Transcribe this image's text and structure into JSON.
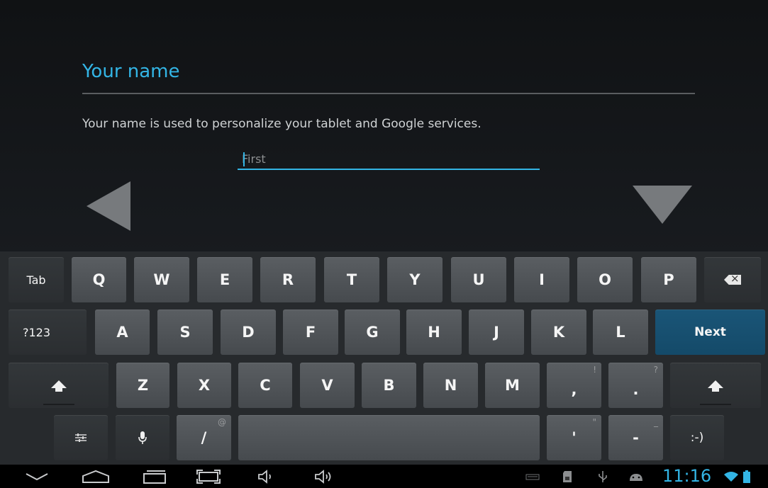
{
  "setup": {
    "title": "Your name",
    "description": "Your name is used to personalize your tablet and Google services.",
    "first_name_placeholder": "First",
    "first_name_value": ""
  },
  "keyboard": {
    "row1": [
      "Tab",
      "Q",
      "W",
      "E",
      "R",
      "T",
      "Y",
      "U",
      "I",
      "O",
      "P"
    ],
    "row2": [
      "?123",
      "A",
      "S",
      "D",
      "F",
      "G",
      "H",
      "J",
      "K",
      "L",
      "Next"
    ],
    "row3": [
      "Z",
      "X",
      "C",
      "V",
      "B",
      "N",
      "M",
      ",",
      "."
    ],
    "row3_hints": {
      "comma": "!",
      "period": "?"
    },
    "row4": {
      "slash": "/",
      "slash_hint": "@",
      "apostrophe": "'",
      "apostrophe_hint": "\"",
      "dash": "-",
      "dash_hint": "_",
      "smiley": ":-)"
    }
  },
  "status": {
    "time": "11:16"
  },
  "colors": {
    "accent": "#33b5e5",
    "next_key": "#1a5577",
    "key": "#505458",
    "func_key": "#2f3235"
  }
}
